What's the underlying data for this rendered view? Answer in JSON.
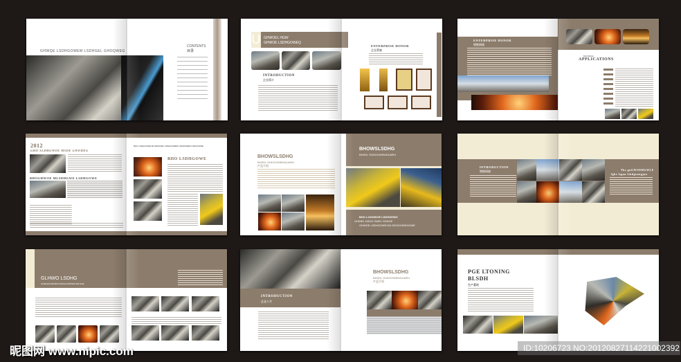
{
  "colors": {
    "background": "#1e1917",
    "accent": "#8c7c6b",
    "cream": "#f3ecd5"
  },
  "spreads": {
    "s1": {
      "headline": "GHWQE LSDHGOWEM LSDHGEL GHOQWEG",
      "contents_en": "CONTENTS",
      "contents_cn": "目录"
    },
    "s2": {
      "initial": "U",
      "title1": "GHWOEL HGW",
      "title2": "GHWOE LSDHGOWEQ",
      "intro_en": "INTRODUCTION",
      "intro_cn": "企业简介",
      "honor_en": "ENTERPRISE HONOR",
      "honor_cn": "企业荣誉"
    },
    "s3": {
      "honor_en": "ENTERPRISE HONOR",
      "honor_cn": "销售网络",
      "app_small": "BHOWEGL",
      "app_title": "APPLICATIONS"
    },
    "s4": {
      "year": "2012",
      "subtitle": "GHO SLDHGWOE MSDE GWEHEG",
      "section": "BHOGHWOE MLSDHGWE LSDHGOWE",
      "top_line": "BHO LSDHGOWE MLSDHGWE LSDHGOWEM LSDHGWEM LSDHGOWE",
      "right_title": "BHO LSDHGOWE"
    },
    "s5": {
      "left_title": "BHOWSLSDHG",
      "left_sub": "BHSDL SHDGOWEMGLWEH",
      "left_cn": "产品介绍",
      "right_title": "BHOWSLSDHG",
      "right_sub": "BHSDL SHDGOWEMGLWEH",
      "bottom1": "BHO LOGHWOE LSDHGEWO",
      "bottom2": "GHWEL HSDG OWEL SDHGE",
      "bottom3": "GHWOE LSDHGOWEJGLSDHGOWEHGWE"
    },
    "s6": {
      "intro_en": "INTRODUCTION",
      "intro_cn": "销售网络",
      "right1": "The guGWOEHGWLE",
      "right2": "lghe lsgan lshdgoaugjan"
    },
    "s7": {
      "title": "GLHWO LSDHG",
      "sub": "GHWLEGHWOEGLSDHGGHWOEGHWLGHE"
    },
    "s8": {
      "intro_en": "INTRODUCTION",
      "intro_cn": "企业人才",
      "title": "BHOWSLSDHG",
      "sub": "BHSDL SHDGOWEMGLWEH",
      "cn": "产品介绍"
    },
    "s9": {
      "title1": "PGE LTONING",
      "title2": "BLSDH",
      "cn": "生产基地"
    }
  },
  "watermark": {
    "site": "昵图网 www.nipic.com",
    "id": "ID:10206723 NO:20120827114221002392"
  }
}
